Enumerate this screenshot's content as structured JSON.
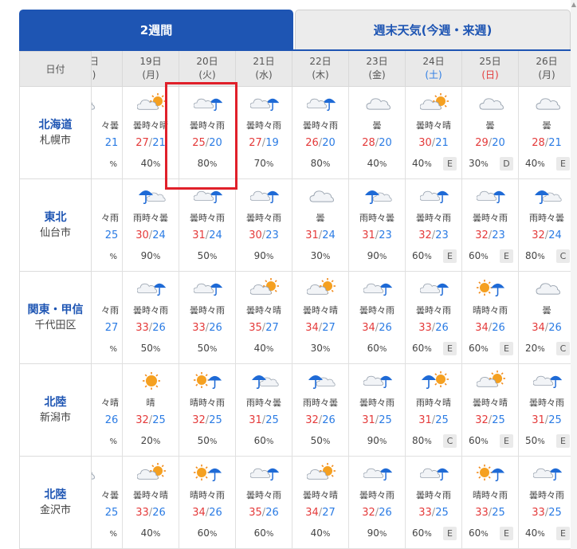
{
  "tabs": [
    {
      "label": "2週間",
      "active": true
    },
    {
      "label": "週末天気(今週・来週)",
      "active": false
    }
  ],
  "date_header_label": "日付",
  "dates": [
    {
      "day": "日",
      "wd": ")",
      "type": "partial"
    },
    {
      "day": "19日",
      "wd": "(月)",
      "type": "weekday"
    },
    {
      "day": "20日",
      "wd": "(火)",
      "type": "weekday"
    },
    {
      "day": "21日",
      "wd": "(水)",
      "type": "weekday"
    },
    {
      "day": "22日",
      "wd": "(木)",
      "type": "weekday"
    },
    {
      "day": "23日",
      "wd": "(金)",
      "type": "weekday"
    },
    {
      "day": "24日",
      "wd": "(土)",
      "type": "sat"
    },
    {
      "day": "25日",
      "wd": "(日)",
      "type": "sun"
    },
    {
      "day": "26日",
      "wd": "(月)",
      "type": "weekday"
    }
  ],
  "regions": [
    {
      "name": "北海道",
      "city": "札幌市",
      "cells": [
        {
          "icon": "cloud",
          "tel": "々曇",
          "max": "",
          "min": "21",
          "pop": "%",
          "rel": ""
        },
        {
          "icon": "cloud-sun",
          "tel": "曇時々晴",
          "max": "27",
          "min": "21",
          "pop": "40",
          "rel": ""
        },
        {
          "icon": "cloud-rain",
          "tel": "曇時々雨",
          "max": "25",
          "min": "20",
          "pop": "80",
          "rel": ""
        },
        {
          "icon": "cloud-rain",
          "tel": "曇時々雨",
          "max": "27",
          "min": "19",
          "pop": "70",
          "rel": ""
        },
        {
          "icon": "cloud-rain",
          "tel": "曇時々雨",
          "max": "26",
          "min": "20",
          "pop": "80",
          "rel": ""
        },
        {
          "icon": "cloud",
          "tel": "曇",
          "max": "28",
          "min": "20",
          "pop": "40",
          "rel": ""
        },
        {
          "icon": "cloud-sun",
          "tel": "曇時々晴",
          "max": "30",
          "min": "21",
          "pop": "40",
          "rel": "E"
        },
        {
          "icon": "cloud",
          "tel": "曇",
          "max": "29",
          "min": "20",
          "pop": "30",
          "rel": "D"
        },
        {
          "icon": "cloud",
          "tel": "曇",
          "max": "28",
          "min": "21",
          "pop": "40",
          "rel": "E"
        }
      ]
    },
    {
      "name": "東北",
      "city": "仙台市",
      "cells": [
        {
          "icon": "rain",
          "tel": "々雨",
          "max": "",
          "min": "25",
          "pop": "%",
          "rel": ""
        },
        {
          "icon": "rain-cloud",
          "tel": "雨時々曇",
          "max": "30",
          "min": "24",
          "pop": "90",
          "rel": ""
        },
        {
          "icon": "cloud-rain",
          "tel": "曇時々雨",
          "max": "31",
          "min": "24",
          "pop": "50",
          "rel": ""
        },
        {
          "icon": "cloud-rain",
          "tel": "曇時々雨",
          "max": "30",
          "min": "23",
          "pop": "90",
          "rel": ""
        },
        {
          "icon": "cloud",
          "tel": "曇",
          "max": "31",
          "min": "24",
          "pop": "30",
          "rel": ""
        },
        {
          "icon": "rain-cloud",
          "tel": "雨時々曇",
          "max": "31",
          "min": "23",
          "pop": "90",
          "rel": ""
        },
        {
          "icon": "cloud-rain",
          "tel": "曇時々雨",
          "max": "32",
          "min": "23",
          "pop": "60",
          "rel": "E"
        },
        {
          "icon": "cloud-rain",
          "tel": "曇時々雨",
          "max": "32",
          "min": "23",
          "pop": "60",
          "rel": "E"
        },
        {
          "icon": "rain-cloud",
          "tel": "雨時々曇",
          "max": "32",
          "min": "24",
          "pop": "80",
          "rel": "C"
        }
      ]
    },
    {
      "name": "関東・甲信",
      "city": "千代田区",
      "cells": [
        {
          "icon": "rain",
          "tel": "々雨",
          "max": "",
          "min": "27",
          "pop": "%",
          "rel": ""
        },
        {
          "icon": "cloud-rain",
          "tel": "曇時々雨",
          "max": "33",
          "min": "26",
          "pop": "50",
          "rel": ""
        },
        {
          "icon": "cloud-rain",
          "tel": "曇時々雨",
          "max": "33",
          "min": "26",
          "pop": "50",
          "rel": ""
        },
        {
          "icon": "cloud-sun",
          "tel": "曇時々晴",
          "max": "35",
          "min": "27",
          "pop": "40",
          "rel": ""
        },
        {
          "icon": "cloud-sun",
          "tel": "曇時々晴",
          "max": "34",
          "min": "27",
          "pop": "30",
          "rel": ""
        },
        {
          "icon": "cloud-rain",
          "tel": "曇時々雨",
          "max": "34",
          "min": "26",
          "pop": "60",
          "rel": ""
        },
        {
          "icon": "cloud-rain",
          "tel": "曇時々雨",
          "max": "33",
          "min": "26",
          "pop": "60",
          "rel": "E"
        },
        {
          "icon": "sun-rain",
          "tel": "晴時々雨",
          "max": "34",
          "min": "26",
          "pop": "60",
          "rel": "E"
        },
        {
          "icon": "cloud",
          "tel": "曇",
          "max": "34",
          "min": "26",
          "pop": "20",
          "rel": "C"
        }
      ]
    },
    {
      "name": "北陸",
      "city": "新潟市",
      "cells": [
        {
          "icon": "sun",
          "tel": "々晴",
          "max": "",
          "min": "26",
          "pop": "%",
          "rel": ""
        },
        {
          "icon": "sun",
          "tel": "晴",
          "max": "32",
          "min": "25",
          "pop": "20",
          "rel": ""
        },
        {
          "icon": "sun-rain",
          "tel": "晴時々雨",
          "max": "32",
          "min": "25",
          "pop": "50",
          "rel": ""
        },
        {
          "icon": "rain-cloud",
          "tel": "雨時々曇",
          "max": "31",
          "min": "25",
          "pop": "60",
          "rel": ""
        },
        {
          "icon": "rain-cloud",
          "tel": "雨時々曇",
          "max": "32",
          "min": "26",
          "pop": "50",
          "rel": ""
        },
        {
          "icon": "cloud-rain",
          "tel": "曇時々雨",
          "max": "31",
          "min": "25",
          "pop": "90",
          "rel": ""
        },
        {
          "icon": "rain-sun",
          "tel": "雨時々晴",
          "max": "31",
          "min": "25",
          "pop": "80",
          "rel": "C"
        },
        {
          "icon": "cloud-sun",
          "tel": "曇時々晴",
          "max": "32",
          "min": "25",
          "pop": "60",
          "rel": "E"
        },
        {
          "icon": "cloud-rain",
          "tel": "曇時々雨",
          "max": "31",
          "min": "25",
          "pop": "50",
          "rel": "E"
        }
      ]
    },
    {
      "name": "北陸",
      "city": "金沢市",
      "cells": [
        {
          "icon": "cloud",
          "tel": "々曇",
          "max": "",
          "min": "25",
          "pop": "%",
          "rel": ""
        },
        {
          "icon": "cloud-sun",
          "tel": "曇時々晴",
          "max": "33",
          "min": "26",
          "pop": "40",
          "rel": ""
        },
        {
          "icon": "sun-rain",
          "tel": "晴時々雨",
          "max": "34",
          "min": "26",
          "pop": "60",
          "rel": ""
        },
        {
          "icon": "cloud-rain",
          "tel": "曇時々雨",
          "max": "35",
          "min": "26",
          "pop": "60",
          "rel": ""
        },
        {
          "icon": "cloud-sun",
          "tel": "曇時々晴",
          "max": "34",
          "min": "27",
          "pop": "40",
          "rel": ""
        },
        {
          "icon": "cloud-rain",
          "tel": "曇時々雨",
          "max": "32",
          "min": "26",
          "pop": "90",
          "rel": ""
        },
        {
          "icon": "cloud-rain",
          "tel": "曇時々雨",
          "max": "33",
          "min": "25",
          "pop": "60",
          "rel": "E"
        },
        {
          "icon": "sun-rain",
          "tel": "晴時々雨",
          "max": "33",
          "min": "25",
          "pop": "60",
          "rel": "E"
        },
        {
          "icon": "cloud-rain",
          "tel": "曇時々雨",
          "max": "33",
          "min": "25",
          "pop": "40",
          "rel": "E"
        }
      ]
    }
  ],
  "colors": {
    "tab_active": "#1e55b3",
    "max_temp": "#e43a3a",
    "min_temp": "#2a7be4",
    "highlight": "#e0202a"
  }
}
